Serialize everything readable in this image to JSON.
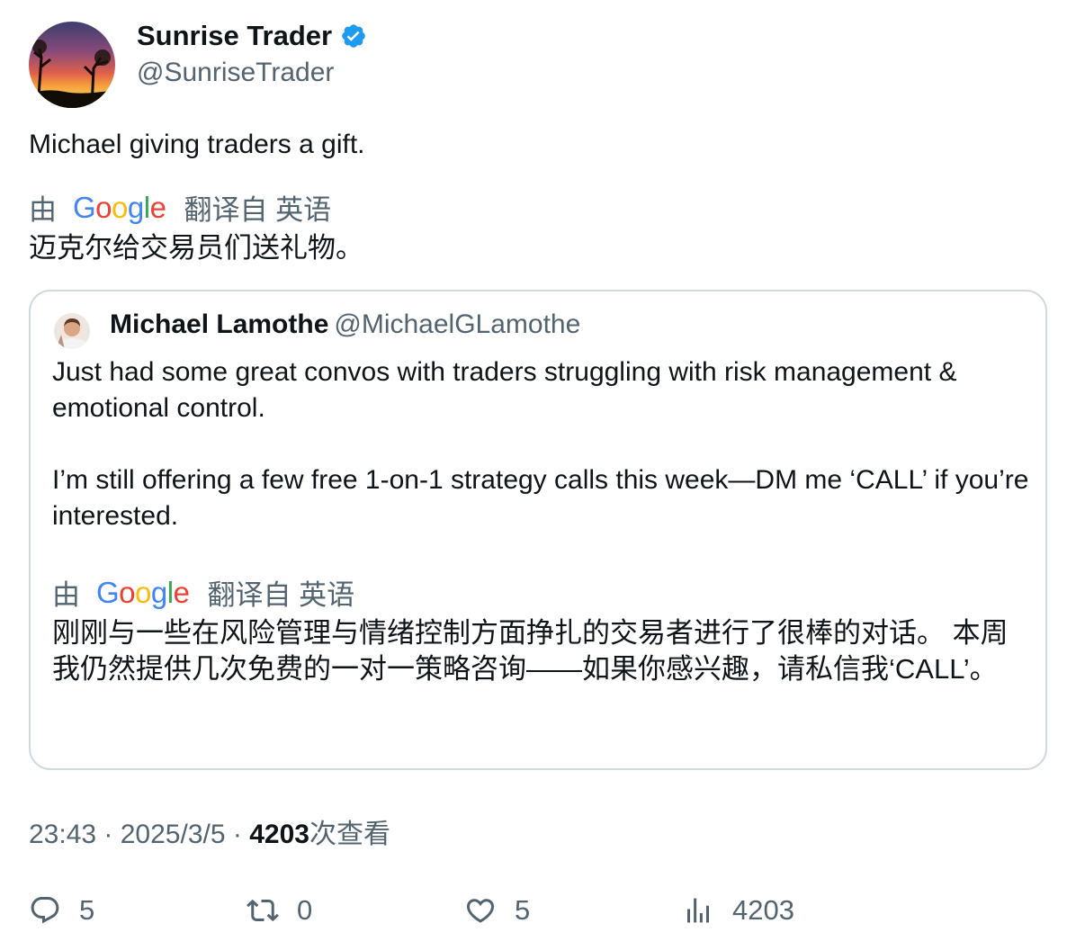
{
  "author": {
    "display_name": "Sunrise Trader",
    "handle": "@SunriseTrader",
    "verified": true,
    "avatar_icon": "sunset-photo-avatar"
  },
  "tweet": {
    "text": "Michael giving traders a gift.",
    "translation_by": "由",
    "translation_logo": "Google",
    "translation_from": "翻译自 英语",
    "translated_text": "迈克尔给交易员们送礼物。"
  },
  "quote": {
    "display_name": "Michael Lamothe",
    "handle": "@MichaelGLamothe",
    "avatar_icon": "portrait-avatar",
    "paragraph_1": "Just had some great convos with traders struggling with risk management & emotional control.",
    "paragraph_2": "I’m still offering a few free 1-on-1 strategy calls this week—DM me ‘CALL’ if you’re interested.",
    "translation_by": "由",
    "translation_logo": "Google",
    "translation_from": "翻译自 英语",
    "translated_text": "刚刚与一些在风险管理与情绪控制方面挣扎的交易者进行了很棒的对话。 本周我仍然提供几次免费的一对一策略咨询——如果你感兴趣，请私信我‘CALL’。"
  },
  "meta": {
    "time": "23:43",
    "date": "2025/3/5",
    "views_count": "4203",
    "views_label": "次查看"
  },
  "actions": {
    "replies": "5",
    "reposts": "0",
    "likes": "5",
    "views": "4203"
  },
  "colors": {
    "verified": "#1d9bf0",
    "secondary_text": "#536471",
    "border": "#cfd9de"
  }
}
